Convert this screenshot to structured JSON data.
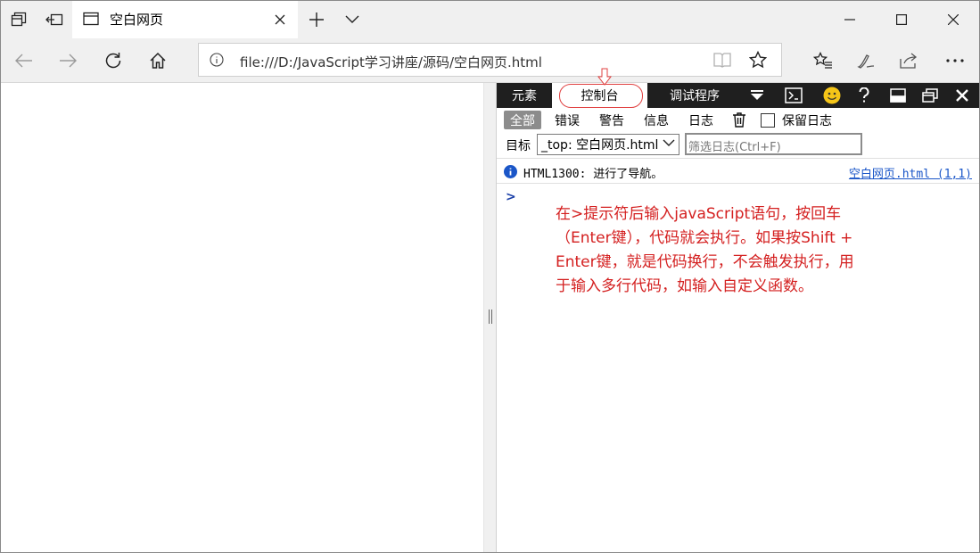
{
  "browser": {
    "tab_title": "空白网页",
    "url": "file:///D:/JavaScript学习讲座/源码/空白网页.html"
  },
  "devtools": {
    "tabs": [
      "元素",
      "控制台",
      "调试程序"
    ],
    "filters": {
      "all": "全部",
      "errors": "错误",
      "warnings": "警告",
      "info": "信息",
      "logs": "日志",
      "preserve_log": "保留日志"
    },
    "target_label": "目标",
    "target_value": "_top: 空白网页.html",
    "filter_placeholder": "筛选日志(Ctrl+F)",
    "message": {
      "text": "HTML1300: 进行了导航。",
      "link": "空白网页.html (1,1)"
    },
    "prompt_symbol": ">"
  },
  "annotation": {
    "text": "在>提示符后输入javaScript语句，按回车（Enter键），代码就会执行。如果按Shift + Enter键，就是代码换行，不会触发执行，用于输入多行代码，如输入自定义函数。",
    "color": "#d42020"
  },
  "colors": {
    "devtools_bar": "#1f1f1f",
    "link": "#1a56c8",
    "highlight": "#e04040"
  }
}
